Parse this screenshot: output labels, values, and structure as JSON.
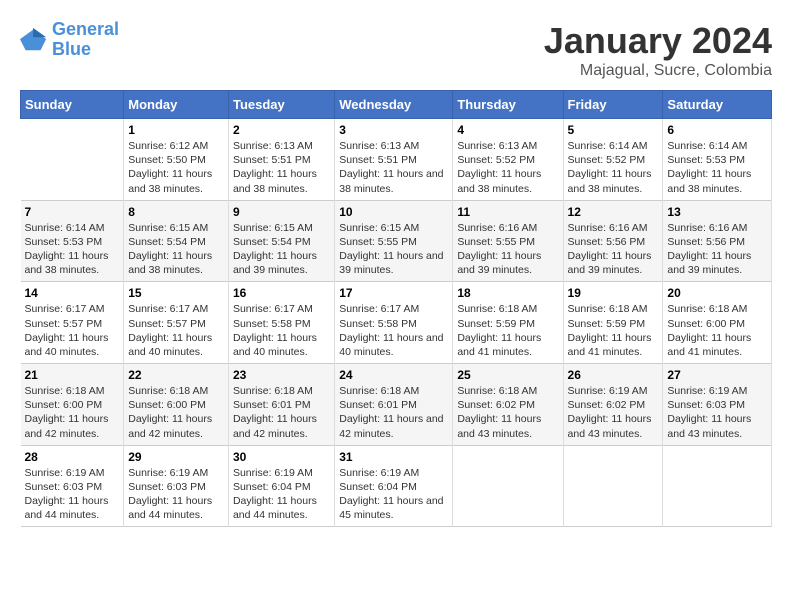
{
  "logo": {
    "line1": "General",
    "line2": "Blue"
  },
  "title": "January 2024",
  "subtitle": "Majagual, Sucre, Colombia",
  "days_header": [
    "Sunday",
    "Monday",
    "Tuesday",
    "Wednesday",
    "Thursday",
    "Friday",
    "Saturday"
  ],
  "weeks": [
    [
      {
        "day": "",
        "sunrise": "",
        "sunset": "",
        "daylight": ""
      },
      {
        "day": "1",
        "sunrise": "Sunrise: 6:12 AM",
        "sunset": "Sunset: 5:50 PM",
        "daylight": "Daylight: 11 hours and 38 minutes."
      },
      {
        "day": "2",
        "sunrise": "Sunrise: 6:13 AM",
        "sunset": "Sunset: 5:51 PM",
        "daylight": "Daylight: 11 hours and 38 minutes."
      },
      {
        "day": "3",
        "sunrise": "Sunrise: 6:13 AM",
        "sunset": "Sunset: 5:51 PM",
        "daylight": "Daylight: 11 hours and 38 minutes."
      },
      {
        "day": "4",
        "sunrise": "Sunrise: 6:13 AM",
        "sunset": "Sunset: 5:52 PM",
        "daylight": "Daylight: 11 hours and 38 minutes."
      },
      {
        "day": "5",
        "sunrise": "Sunrise: 6:14 AM",
        "sunset": "Sunset: 5:52 PM",
        "daylight": "Daylight: 11 hours and 38 minutes."
      },
      {
        "day": "6",
        "sunrise": "Sunrise: 6:14 AM",
        "sunset": "Sunset: 5:53 PM",
        "daylight": "Daylight: 11 hours and 38 minutes."
      }
    ],
    [
      {
        "day": "7",
        "sunrise": "Sunrise: 6:14 AM",
        "sunset": "Sunset: 5:53 PM",
        "daylight": "Daylight: 11 hours and 38 minutes."
      },
      {
        "day": "8",
        "sunrise": "Sunrise: 6:15 AM",
        "sunset": "Sunset: 5:54 PM",
        "daylight": "Daylight: 11 hours and 38 minutes."
      },
      {
        "day": "9",
        "sunrise": "Sunrise: 6:15 AM",
        "sunset": "Sunset: 5:54 PM",
        "daylight": "Daylight: 11 hours and 39 minutes."
      },
      {
        "day": "10",
        "sunrise": "Sunrise: 6:15 AM",
        "sunset": "Sunset: 5:55 PM",
        "daylight": "Daylight: 11 hours and 39 minutes."
      },
      {
        "day": "11",
        "sunrise": "Sunrise: 6:16 AM",
        "sunset": "Sunset: 5:55 PM",
        "daylight": "Daylight: 11 hours and 39 minutes."
      },
      {
        "day": "12",
        "sunrise": "Sunrise: 6:16 AM",
        "sunset": "Sunset: 5:56 PM",
        "daylight": "Daylight: 11 hours and 39 minutes."
      },
      {
        "day": "13",
        "sunrise": "Sunrise: 6:16 AM",
        "sunset": "Sunset: 5:56 PM",
        "daylight": "Daylight: 11 hours and 39 minutes."
      }
    ],
    [
      {
        "day": "14",
        "sunrise": "Sunrise: 6:17 AM",
        "sunset": "Sunset: 5:57 PM",
        "daylight": "Daylight: 11 hours and 40 minutes."
      },
      {
        "day": "15",
        "sunrise": "Sunrise: 6:17 AM",
        "sunset": "Sunset: 5:57 PM",
        "daylight": "Daylight: 11 hours and 40 minutes."
      },
      {
        "day": "16",
        "sunrise": "Sunrise: 6:17 AM",
        "sunset": "Sunset: 5:58 PM",
        "daylight": "Daylight: 11 hours and 40 minutes."
      },
      {
        "day": "17",
        "sunrise": "Sunrise: 6:17 AM",
        "sunset": "Sunset: 5:58 PM",
        "daylight": "Daylight: 11 hours and 40 minutes."
      },
      {
        "day": "18",
        "sunrise": "Sunrise: 6:18 AM",
        "sunset": "Sunset: 5:59 PM",
        "daylight": "Daylight: 11 hours and 41 minutes."
      },
      {
        "day": "19",
        "sunrise": "Sunrise: 6:18 AM",
        "sunset": "Sunset: 5:59 PM",
        "daylight": "Daylight: 11 hours and 41 minutes."
      },
      {
        "day": "20",
        "sunrise": "Sunrise: 6:18 AM",
        "sunset": "Sunset: 6:00 PM",
        "daylight": "Daylight: 11 hours and 41 minutes."
      }
    ],
    [
      {
        "day": "21",
        "sunrise": "Sunrise: 6:18 AM",
        "sunset": "Sunset: 6:00 PM",
        "daylight": "Daylight: 11 hours and 42 minutes."
      },
      {
        "day": "22",
        "sunrise": "Sunrise: 6:18 AM",
        "sunset": "Sunset: 6:00 PM",
        "daylight": "Daylight: 11 hours and 42 minutes."
      },
      {
        "day": "23",
        "sunrise": "Sunrise: 6:18 AM",
        "sunset": "Sunset: 6:01 PM",
        "daylight": "Daylight: 11 hours and 42 minutes."
      },
      {
        "day": "24",
        "sunrise": "Sunrise: 6:18 AM",
        "sunset": "Sunset: 6:01 PM",
        "daylight": "Daylight: 11 hours and 42 minutes."
      },
      {
        "day": "25",
        "sunrise": "Sunrise: 6:18 AM",
        "sunset": "Sunset: 6:02 PM",
        "daylight": "Daylight: 11 hours and 43 minutes."
      },
      {
        "day": "26",
        "sunrise": "Sunrise: 6:19 AM",
        "sunset": "Sunset: 6:02 PM",
        "daylight": "Daylight: 11 hours and 43 minutes."
      },
      {
        "day": "27",
        "sunrise": "Sunrise: 6:19 AM",
        "sunset": "Sunset: 6:03 PM",
        "daylight": "Daylight: 11 hours and 43 minutes."
      }
    ],
    [
      {
        "day": "28",
        "sunrise": "Sunrise: 6:19 AM",
        "sunset": "Sunset: 6:03 PM",
        "daylight": "Daylight: 11 hours and 44 minutes."
      },
      {
        "day": "29",
        "sunrise": "Sunrise: 6:19 AM",
        "sunset": "Sunset: 6:03 PM",
        "daylight": "Daylight: 11 hours and 44 minutes."
      },
      {
        "day": "30",
        "sunrise": "Sunrise: 6:19 AM",
        "sunset": "Sunset: 6:04 PM",
        "daylight": "Daylight: 11 hours and 44 minutes."
      },
      {
        "day": "31",
        "sunrise": "Sunrise: 6:19 AM",
        "sunset": "Sunset: 6:04 PM",
        "daylight": "Daylight: 11 hours and 45 minutes."
      },
      {
        "day": "",
        "sunrise": "",
        "sunset": "",
        "daylight": ""
      },
      {
        "day": "",
        "sunrise": "",
        "sunset": "",
        "daylight": ""
      },
      {
        "day": "",
        "sunrise": "",
        "sunset": "",
        "daylight": ""
      }
    ]
  ]
}
